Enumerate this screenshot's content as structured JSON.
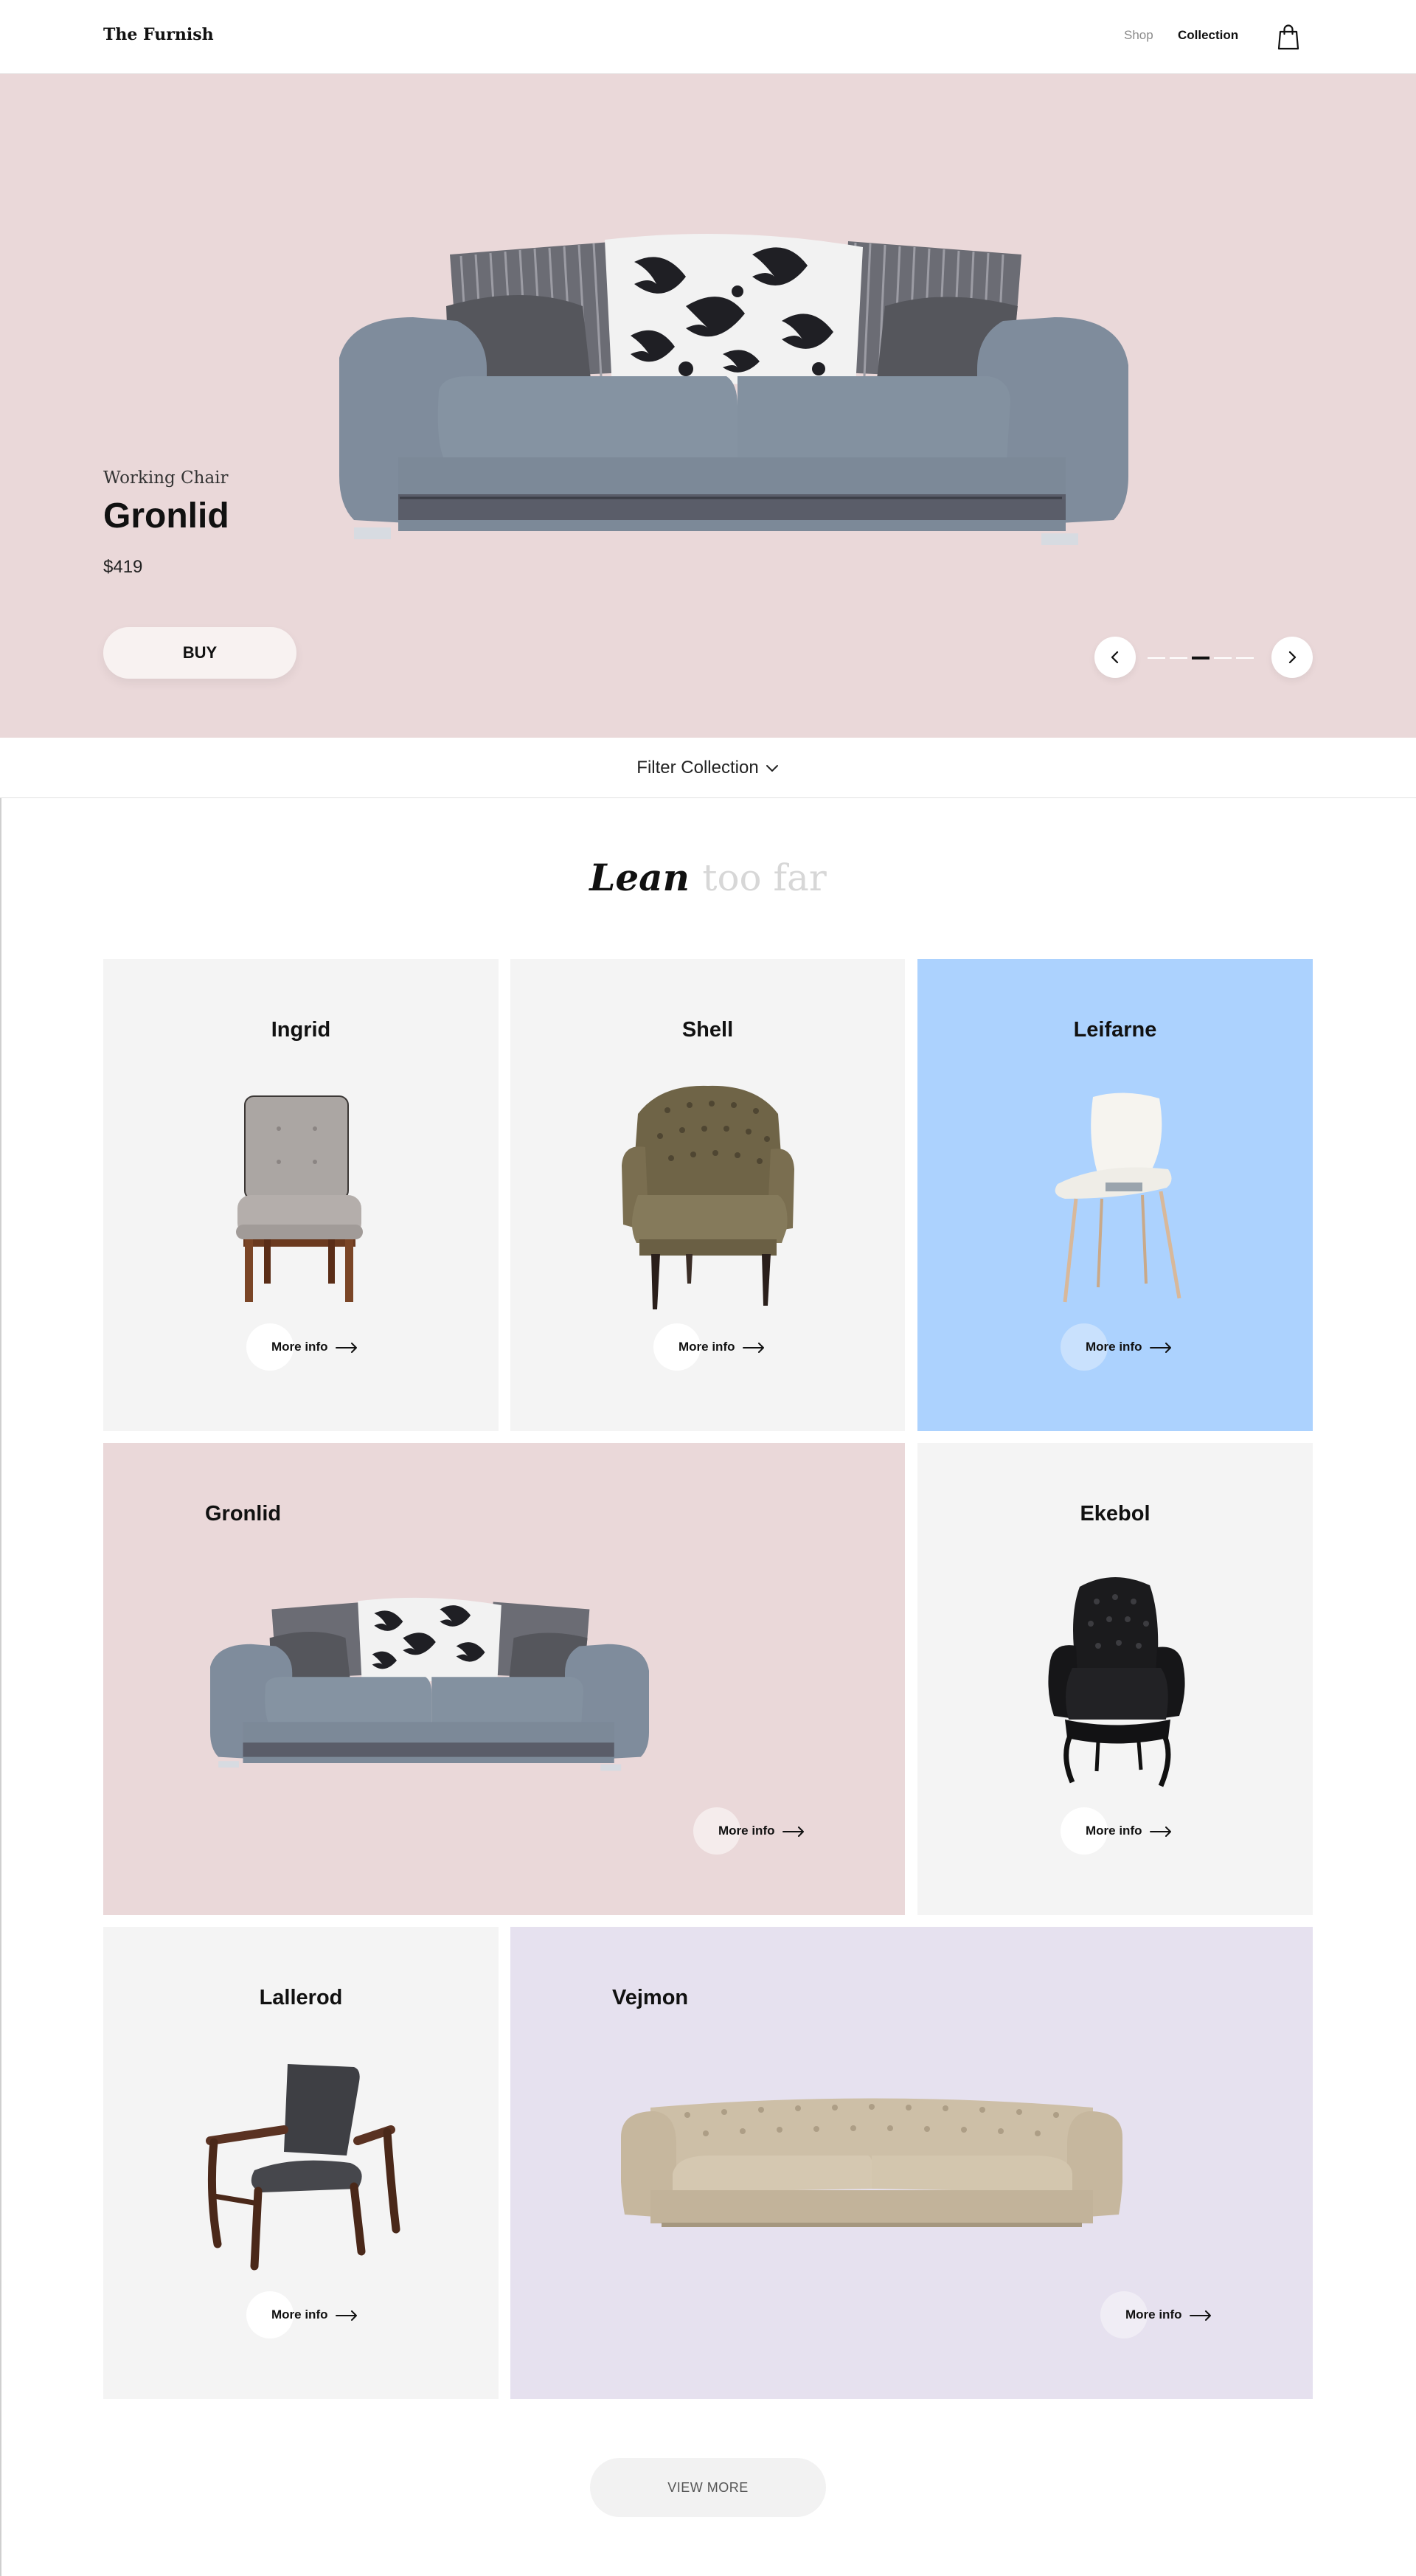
{
  "header": {
    "logo": "The Furnish",
    "nav": {
      "shop": "Shop",
      "collection": "Collection"
    },
    "cart_icon": "shopping-bag-icon"
  },
  "hero": {
    "category": "Working Chair",
    "name": "Gronlid",
    "price": "$419",
    "buy_label": "BUY",
    "slider": {
      "prev_icon": "chevron-left-icon",
      "next_icon": "chevron-right-icon",
      "slide_count": 5,
      "active_slide": 3
    },
    "background": "#ead8d9"
  },
  "filter": {
    "label": "Filter Collection",
    "icon": "chevron-down-icon"
  },
  "section_title": {
    "bold": "Lean",
    "light": "too far"
  },
  "products": [
    {
      "name": "Ingrid",
      "more_info": "More info",
      "background": "#f4f4f4"
    },
    {
      "name": "Shell",
      "more_info": "More info",
      "background": "#f4f4f4"
    },
    {
      "name": "Leifarne",
      "more_info": "More info",
      "background": "#acd2fe"
    },
    {
      "name": "Gronlid",
      "more_info": "More info",
      "background": "#ead8d9"
    },
    {
      "name": "Ekebol",
      "more_info": "More info",
      "background": "#f4f4f4"
    },
    {
      "name": "Lallerod",
      "more_info": "More info",
      "background": "#f4f4f4"
    },
    {
      "name": "Vejmon",
      "more_info": "More info",
      "background": "#e6e1ef"
    }
  ],
  "view_more_label": "VIEW MORE"
}
